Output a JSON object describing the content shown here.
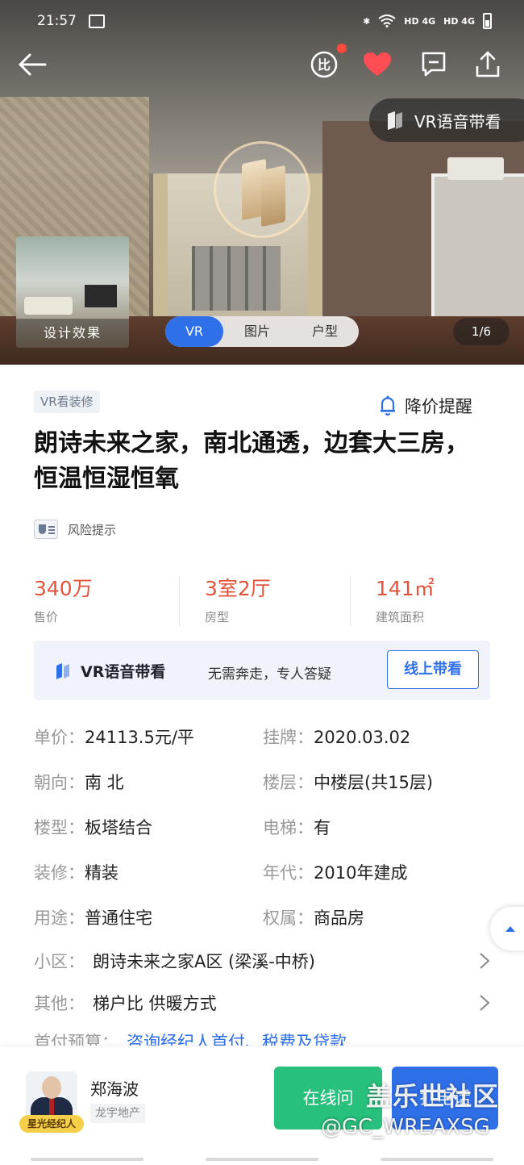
{
  "status_bar": {
    "time": "21:57",
    "net1": "HD 4G",
    "net2": "HD 4G"
  },
  "hero": {
    "vr_voice_label": "VR语音带看",
    "design_effect_label": "设计效果",
    "tabs": [
      "VR",
      "图片",
      "户型"
    ],
    "active_tab": "VR",
    "page_counter": "1/6",
    "heart_color": "#ff4d55"
  },
  "listing": {
    "vr_tag": "VR看装修",
    "price_alert": "降价提醒",
    "title": "朗诗未来之家，南北通透，边套大三房，恒温恒湿恒氧",
    "risk_label": "风险提示"
  },
  "stats": [
    {
      "value": "340万",
      "label": "售价"
    },
    {
      "value": "3室2厅",
      "label": "房型"
    },
    {
      "value": "141㎡",
      "label": "建筑面积"
    }
  ],
  "vr_banner": {
    "title": "VR语音带看",
    "subtitle": "无需奔走，专人答疑",
    "button": "线上带看"
  },
  "details": [
    {
      "k1": "单价：",
      "v1": "24113.5元/平",
      "k2": "挂牌：",
      "v2": "2020.03.02"
    },
    {
      "k1": "朝向：",
      "v1": "南 北",
      "k2": "楼层：",
      "v2": "中楼层(共15层)"
    },
    {
      "k1": "楼型：",
      "v1": "板塔结合",
      "k2": "电梯：",
      "v2": "有"
    },
    {
      "k1": "装修：",
      "v1": "精装",
      "k2": "年代：",
      "v2": "2010年建成"
    },
    {
      "k1": "用途：",
      "v1": "普通住宅",
      "k2": "权属：",
      "v2": "商品房"
    }
  ],
  "community": {
    "key": "小区：",
    "value": "朗诗未来之家A区 (梁溪-中桥)"
  },
  "other": {
    "key": "其他：",
    "value": "梯户比 供暖方式"
  },
  "payment": {
    "key": "首付预算：",
    "value": "咨询经纪人首付、税费及贷款"
  },
  "agent": {
    "name": "郑海波",
    "company": "龙宇地产",
    "badge": "星光经纪人",
    "ask_button": "在线问",
    "call_button": "打电话"
  },
  "watermark": {
    "line1": "盖乐世社区",
    "line2": "@GC_WREAXSG"
  },
  "colors": {
    "accent_blue": "#2f6fe8",
    "price_red": "#e5533b",
    "green": "#28c07d"
  }
}
